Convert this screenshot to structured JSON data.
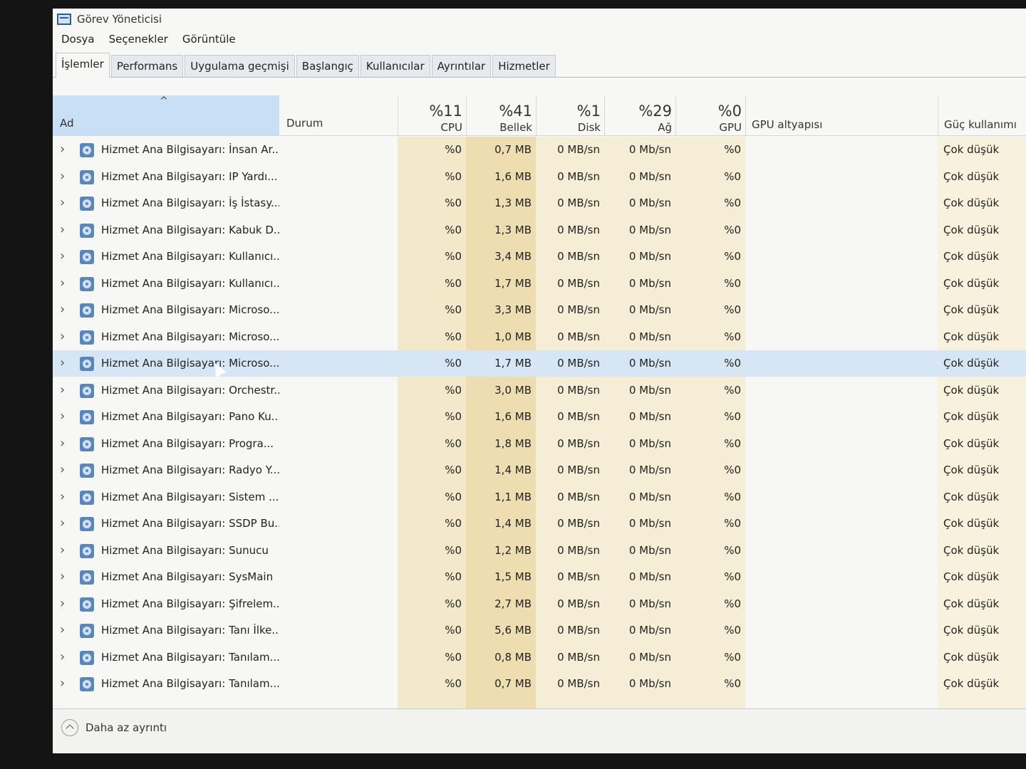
{
  "window": {
    "title": "Görev Yöneticisi"
  },
  "menu": [
    "Dosya",
    "Seçenekler",
    "Görüntüle"
  ],
  "tabs": [
    "İşlemler",
    "Performans",
    "Uygulama geçmişi",
    "Başlangıç",
    "Kullanıcılar",
    "Ayrıntılar",
    "Hizmetler"
  ],
  "columns": {
    "name": "Ad",
    "status": "Durum",
    "cpu": {
      "pct": "%11",
      "label": "CPU"
    },
    "memory": {
      "pct": "%41",
      "label": "Bellek"
    },
    "disk": {
      "pct": "%1",
      "label": "Disk"
    },
    "network": {
      "pct": "%29",
      "label": "Ağ"
    },
    "gpu": {
      "pct": "%0",
      "label": "GPU"
    },
    "gpu_engine": "GPU altyapısı",
    "power": "Güç kullanımı"
  },
  "rows": [
    {
      "name": "Hizmet Ana Bilgisayarı: İnsan Ar...",
      "cpu": "%0",
      "mem": "0,7 MB",
      "disk": "0 MB/sn",
      "net": "0 Mb/sn",
      "gpu": "%0",
      "power": "Çok düşük"
    },
    {
      "name": "Hizmet Ana Bilgisayarı: IP Yardı...",
      "cpu": "%0",
      "mem": "1,6 MB",
      "disk": "0 MB/sn",
      "net": "0 Mb/sn",
      "gpu": "%0",
      "power": "Çok düşük"
    },
    {
      "name": "Hizmet Ana Bilgisayarı: İş İstasy...",
      "cpu": "%0",
      "mem": "1,3 MB",
      "disk": "0 MB/sn",
      "net": "0 Mb/sn",
      "gpu": "%0",
      "power": "Çok düşük"
    },
    {
      "name": "Hizmet Ana Bilgisayarı: Kabuk D...",
      "cpu": "%0",
      "mem": "1,3 MB",
      "disk": "0 MB/sn",
      "net": "0 Mb/sn",
      "gpu": "%0",
      "power": "Çok düşük"
    },
    {
      "name": "Hizmet Ana Bilgisayarı: Kullanıcı...",
      "cpu": "%0",
      "mem": "3,4 MB",
      "disk": "0 MB/sn",
      "net": "0 Mb/sn",
      "gpu": "%0",
      "power": "Çok düşük"
    },
    {
      "name": "Hizmet Ana Bilgisayarı: Kullanıcı...",
      "cpu": "%0",
      "mem": "1,7 MB",
      "disk": "0 MB/sn",
      "net": "0 Mb/sn",
      "gpu": "%0",
      "power": "Çok düşük"
    },
    {
      "name": "Hizmet Ana Bilgisayarı: Microso...",
      "cpu": "%0",
      "mem": "3,3 MB",
      "disk": "0 MB/sn",
      "net": "0 Mb/sn",
      "gpu": "%0",
      "power": "Çok düşük"
    },
    {
      "name": "Hizmet Ana Bilgisayarı: Microso...",
      "cpu": "%0",
      "mem": "1,0 MB",
      "disk": "0 MB/sn",
      "net": "0 Mb/sn",
      "gpu": "%0",
      "power": "Çok düşük"
    },
    {
      "name": "Hizmet Ana Bilgisayarı: Microso...",
      "cpu": "%0",
      "mem": "1,7 MB",
      "disk": "0 MB/sn",
      "net": "0 Mb/sn",
      "gpu": "%0",
      "power": "Çok düşük",
      "selected": true
    },
    {
      "name": "Hizmet Ana Bilgisayarı: Orchestr...",
      "cpu": "%0",
      "mem": "3,0 MB",
      "disk": "0 MB/sn",
      "net": "0 Mb/sn",
      "gpu": "%0",
      "power": "Çok düşük"
    },
    {
      "name": "Hizmet Ana Bilgisayarı: Pano Ku...",
      "cpu": "%0",
      "mem": "1,6 MB",
      "disk": "0 MB/sn",
      "net": "0 Mb/sn",
      "gpu": "%0",
      "power": "Çok düşük"
    },
    {
      "name": "Hizmet Ana Bilgisayarı: Progra...",
      "cpu": "%0",
      "mem": "1,8 MB",
      "disk": "0 MB/sn",
      "net": "0 Mb/sn",
      "gpu": "%0",
      "power": "Çok düşük"
    },
    {
      "name": "Hizmet Ana Bilgisayarı: Radyo Y...",
      "cpu": "%0",
      "mem": "1,4 MB",
      "disk": "0 MB/sn",
      "net": "0 Mb/sn",
      "gpu": "%0",
      "power": "Çok düşük"
    },
    {
      "name": "Hizmet Ana Bilgisayarı: Sistem ...",
      "cpu": "%0",
      "mem": "1,1 MB",
      "disk": "0 MB/sn",
      "net": "0 Mb/sn",
      "gpu": "%0",
      "power": "Çok düşük"
    },
    {
      "name": "Hizmet Ana Bilgisayarı: SSDP Bu...",
      "cpu": "%0",
      "mem": "1,4 MB",
      "disk": "0 MB/sn",
      "net": "0 Mb/sn",
      "gpu": "%0",
      "power": "Çok düşük"
    },
    {
      "name": "Hizmet Ana Bilgisayarı: Sunucu",
      "cpu": "%0",
      "mem": "1,2 MB",
      "disk": "0 MB/sn",
      "net": "0 Mb/sn",
      "gpu": "%0",
      "power": "Çok düşük"
    },
    {
      "name": "Hizmet Ana Bilgisayarı: SysMain",
      "cpu": "%0",
      "mem": "1,5 MB",
      "disk": "0 MB/sn",
      "net": "0 Mb/sn",
      "gpu": "%0",
      "power": "Çok düşük"
    },
    {
      "name": "Hizmet Ana Bilgisayarı: Şifrelem...",
      "cpu": "%0",
      "mem": "2,7 MB",
      "disk": "0 MB/sn",
      "net": "0 Mb/sn",
      "gpu": "%0",
      "power": "Çok düşük"
    },
    {
      "name": "Hizmet Ana Bilgisayarı: Tanı İlke...",
      "cpu": "%0",
      "mem": "5,6 MB",
      "disk": "0 MB/sn",
      "net": "0 Mb/sn",
      "gpu": "%0",
      "power": "Çok düşük"
    },
    {
      "name": "Hizmet Ana Bilgisayarı: Tanılam...",
      "cpu": "%0",
      "mem": "0,8 MB",
      "disk": "0 MB/sn",
      "net": "0 Mb/sn",
      "gpu": "%0",
      "power": "Çok düşük"
    },
    {
      "name": "Hizmet Ana Bilgisayarı: Tanılam...",
      "cpu": "%0",
      "mem": "0,7 MB",
      "disk": "0 MB/sn",
      "net": "0 Mb/sn",
      "gpu": "%0",
      "power": "Çok düşük"
    }
  ],
  "footer": {
    "fewer_details": "Daha az ayrıntı"
  }
}
